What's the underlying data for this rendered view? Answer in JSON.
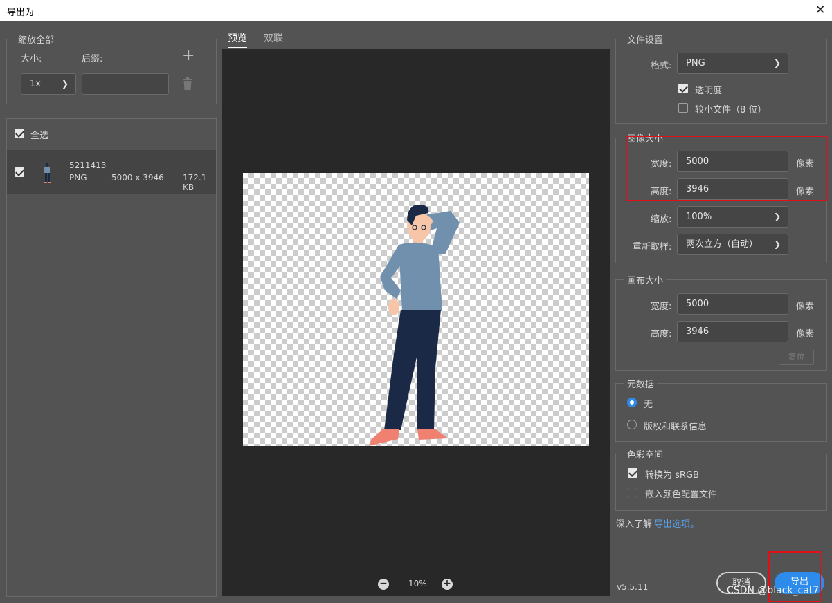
{
  "window": {
    "title": "导出为",
    "close_glyph": "✕"
  },
  "scale_all": {
    "legend": "缩放全部",
    "size_label": "大小:",
    "suffix_label": "后缀:",
    "size_value": "1x",
    "suffix_value": "",
    "add_glyph": "+",
    "delete_icon": "trash-icon"
  },
  "asset_list": {
    "select_all_label": "全选",
    "items": [
      {
        "name": "5211413",
        "format": "PNG",
        "dimensions": "5000 x 3946",
        "size": "172.1 KB"
      }
    ]
  },
  "preview": {
    "tabs": [
      "预览",
      "双联"
    ],
    "active_tab": 0,
    "zoom": "10%",
    "zoom_out": "−",
    "zoom_in": "+"
  },
  "file_settings": {
    "legend": "文件设置",
    "format_label": "格式:",
    "format_value": "PNG",
    "transparency_label": "透明度",
    "transparency_checked": true,
    "smaller_file_label": "较小文件（8 位）",
    "smaller_file_checked": false
  },
  "image_size": {
    "legend": "图像大小",
    "width_label": "宽度:",
    "width_value": "5000",
    "height_label": "高度:",
    "height_value": "3946",
    "unit": "像素",
    "scale_label": "缩放:",
    "scale_value": "100%",
    "resample_label": "重新取样:",
    "resample_value": "两次立方（自动）"
  },
  "canvas_size": {
    "legend": "画布大小",
    "width_label": "宽度:",
    "width_value": "5000",
    "height_label": "高度:",
    "height_value": "3946",
    "unit": "像素",
    "reset_label": "复位"
  },
  "metadata": {
    "legend": "元数据",
    "options": [
      "无",
      "版权和联系信息"
    ],
    "selected": 0
  },
  "color_space": {
    "legend": "色彩空间",
    "convert_srgb_label": "转换为 sRGB",
    "convert_srgb_checked": true,
    "embed_profile_label": "嵌入颜色配置文件",
    "embed_profile_checked": false
  },
  "footer": {
    "learn_more_prefix": "深入了解",
    "learn_more_link": "导出选项。",
    "version": "v5.5.11",
    "cancel_label": "取消",
    "export_label": "导出",
    "watermark": "CSDN @black_cat7"
  },
  "colors": {
    "accent": "#2d8ceb",
    "link": "#5aa4f0",
    "highlight": "#e0101b",
    "shirt": "#7190ad",
    "pants": "#1a2945",
    "skin": "#f7c5a8",
    "shoes": "#f08070",
    "hair": "#1a2945"
  }
}
